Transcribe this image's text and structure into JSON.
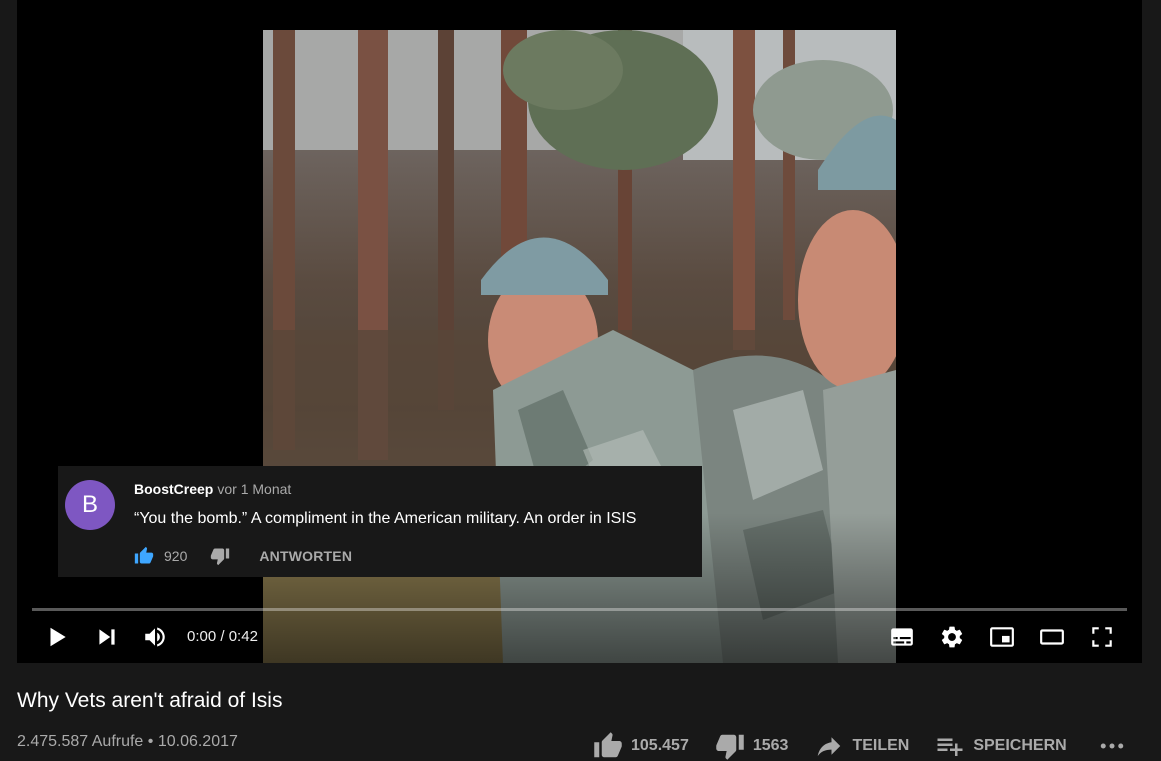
{
  "player": {
    "time_current": "0:00",
    "time_separator": "/",
    "time_duration": "0:42",
    "progress": 0
  },
  "comment": {
    "avatar_letter": "B",
    "avatar_color": "#7e57c2",
    "author": "BoostCreep",
    "time": "vor 1 Monat",
    "text": "“You the bomb.” A compliment in the American military. An order in ISIS",
    "likes": "920",
    "reply_label": "ANTWORTEN"
  },
  "video": {
    "title": "Why Vets aren't afraid of Isis",
    "meta": "2.475.587 Aufrufe • 10.06.2017"
  },
  "actions": {
    "like_count": "105.457",
    "dislike_count": "1563",
    "share_label": "TEILEN",
    "save_label": "SPEICHERN"
  },
  "icons": {
    "play": "play-icon",
    "next": "next-icon",
    "volume": "volume-icon",
    "subtitles": "subtitles-icon",
    "settings": "gear-icon",
    "miniplayer": "miniplayer-icon",
    "theater": "theater-mode-icon",
    "fullscreen": "fullscreen-icon",
    "like": "thumbs-up-icon",
    "dislike": "thumbs-down-icon",
    "share": "share-icon",
    "save": "playlist-add-icon",
    "more": "more-icon"
  },
  "colors": {
    "background": "#181818",
    "accent_like": "#3ea6ff",
    "muted_text": "#aaaaaa",
    "progress_played": "#ff0000"
  }
}
